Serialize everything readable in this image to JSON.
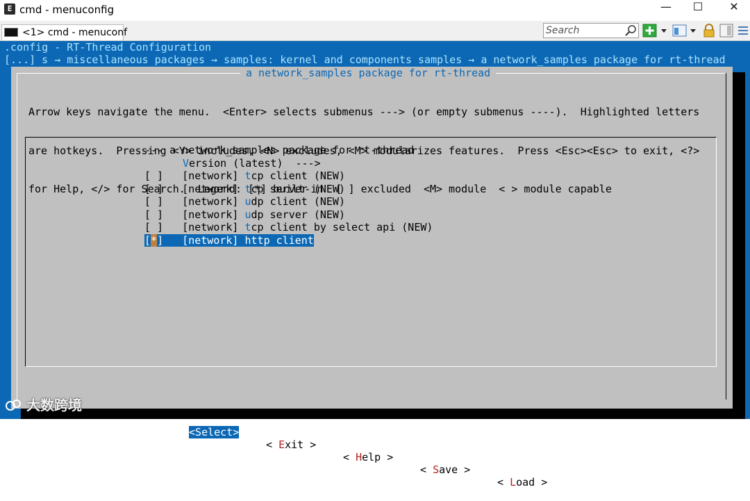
{
  "window": {
    "title": "cmd - menuconfig",
    "app_icon_glyph": "E",
    "minimize": "—",
    "maximize": "☐",
    "close": "✕"
  },
  "tab": {
    "label": "<1> cmd - menuconf"
  },
  "search": {
    "placeholder": "Search"
  },
  "terminal": {
    "line1": ".config - RT-Thread Configuration",
    "line2": "[...] s → miscellaneous packages → samples: kernel and components samples → a network_samples package for rt-thread",
    "dialog_title": "a network_samples package for rt-thread",
    "help": [
      "Arrow keys navigate the menu.  <Enter> selects submenus ---> (or empty submenus ----).  Highlighted letters",
      "are hotkeys.  Pressing <Y> includes, <N> excludes, <M> modularizes features.  Press <Esc><Esc> to exit, <?>",
      "for Help, </> for Search.  Legend: [*] built-in  [ ] excluded  <M> module  < > module capable"
    ],
    "menu": {
      "header": "--- a network_samples package for rt-thread",
      "version_hot": "V",
      "version_rest": "ersion (latest)  --->",
      "items": [
        {
          "check": "[ ]",
          "prefix": "[network] ",
          "hot": "t",
          "rest": "cp client (NEW)"
        },
        {
          "check": "[ ]",
          "prefix": "[network] ",
          "hot": "t",
          "rest": "cp server (NEW)"
        },
        {
          "check": "[ ]",
          "prefix": "[network] ",
          "hot": "u",
          "rest": "dp client (NEW)"
        },
        {
          "check": "[ ]",
          "prefix": "[network] ",
          "hot": "u",
          "rest": "dp server (NEW)"
        },
        {
          "check": "[ ]",
          "prefix": "[network] ",
          "hot": "t",
          "rest": "cp client by select api (NEW)"
        },
        {
          "check_open": "[",
          "check_star": "*",
          "check_close": "]",
          "prefix": "[network] ",
          "hot": "h",
          "rest": "ttp client",
          "selected": true
        }
      ]
    },
    "buttons": [
      {
        "open": "<",
        "hot": "S",
        "rest": "elect",
        "close": ">",
        "selected": true
      },
      {
        "open": "< ",
        "hot": "E",
        "rest": "xit",
        "close": " >"
      },
      {
        "open": "< ",
        "hot": "H",
        "rest": "elp",
        "close": " >"
      },
      {
        "open": "< ",
        "hot": "S",
        "rest": "ave",
        "close": " >"
      },
      {
        "open": "< ",
        "hot": "L",
        "rest": "oad",
        "close": " >"
      }
    ]
  },
  "watermark": "大数跨境",
  "colors": {
    "terminal_bg": "#0c68b4",
    "dialog_bg": "#c0c0c0",
    "hotkey_button": "#b42222",
    "selected_star": "#c08040"
  }
}
